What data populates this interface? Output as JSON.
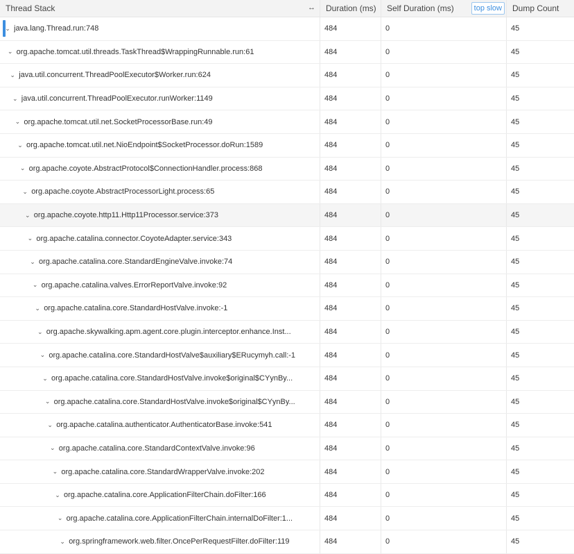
{
  "header": {
    "thread_stack": "Thread Stack",
    "resize_icon": "↔",
    "duration": "Duration (ms)",
    "self_duration": "Self Duration (ms)",
    "top_slow": "top slow",
    "dump_count": "Dump Count"
  },
  "rows": [
    {
      "label": "java.lang.Thread.run:748",
      "duration": "484",
      "self": "0",
      "count": "45"
    },
    {
      "label": "org.apache.tomcat.util.threads.TaskThread$WrappingRunnable.run:61",
      "duration": "484",
      "self": "0",
      "count": "45"
    },
    {
      "label": "java.util.concurrent.ThreadPoolExecutor$Worker.run:624",
      "duration": "484",
      "self": "0",
      "count": "45"
    },
    {
      "label": "java.util.concurrent.ThreadPoolExecutor.runWorker:1149",
      "duration": "484",
      "self": "0",
      "count": "45"
    },
    {
      "label": "org.apache.tomcat.util.net.SocketProcessorBase.run:49",
      "duration": "484",
      "self": "0",
      "count": "45"
    },
    {
      "label": "org.apache.tomcat.util.net.NioEndpoint$SocketProcessor.doRun:1589",
      "duration": "484",
      "self": "0",
      "count": "45"
    },
    {
      "label": "org.apache.coyote.AbstractProtocol$ConnectionHandler.process:868",
      "duration": "484",
      "self": "0",
      "count": "45"
    },
    {
      "label": "org.apache.coyote.AbstractProcessorLight.process:65",
      "duration": "484",
      "self": "0",
      "count": "45"
    },
    {
      "label": "org.apache.coyote.http11.Http11Processor.service:373",
      "duration": "484",
      "self": "0",
      "count": "45"
    },
    {
      "label": "org.apache.catalina.connector.CoyoteAdapter.service:343",
      "duration": "484",
      "self": "0",
      "count": "45"
    },
    {
      "label": "org.apache.catalina.core.StandardEngineValve.invoke:74",
      "duration": "484",
      "self": "0",
      "count": "45"
    },
    {
      "label": "org.apache.catalina.valves.ErrorReportValve.invoke:92",
      "duration": "484",
      "self": "0",
      "count": "45"
    },
    {
      "label": "org.apache.catalina.core.StandardHostValve.invoke:-1",
      "duration": "484",
      "self": "0",
      "count": "45"
    },
    {
      "label": "org.apache.skywalking.apm.agent.core.plugin.interceptor.enhance.Inst...",
      "duration": "484",
      "self": "0",
      "count": "45"
    },
    {
      "label": "org.apache.catalina.core.StandardHostValve$auxiliary$ERucymyh.call:-1",
      "duration": "484",
      "self": "0",
      "count": "45"
    },
    {
      "label": "org.apache.catalina.core.StandardHostValve.invoke$original$CYynBy...",
      "duration": "484",
      "self": "0",
      "count": "45"
    },
    {
      "label": "org.apache.catalina.core.StandardHostValve.invoke$original$CYynBy...",
      "duration": "484",
      "self": "0",
      "count": "45"
    },
    {
      "label": "org.apache.catalina.authenticator.AuthenticatorBase.invoke:541",
      "duration": "484",
      "self": "0",
      "count": "45"
    },
    {
      "label": "org.apache.catalina.core.StandardContextValve.invoke:96",
      "duration": "484",
      "self": "0",
      "count": "45"
    },
    {
      "label": "org.apache.catalina.core.StandardWrapperValve.invoke:202",
      "duration": "484",
      "self": "0",
      "count": "45"
    },
    {
      "label": "org.apache.catalina.core.ApplicationFilterChain.doFilter:166",
      "duration": "484",
      "self": "0",
      "count": "45"
    },
    {
      "label": "org.apache.catalina.core.ApplicationFilterChain.internalDoFilter:1...",
      "duration": "484",
      "self": "0",
      "count": "45"
    },
    {
      "label": "org.springframework.web.filter.OncePerRequestFilter.doFilter:119",
      "duration": "484",
      "self": "0",
      "count": "45"
    }
  ],
  "selected_row": 0,
  "hovered_row": 8,
  "colors": {
    "accent": "#3d8fe0",
    "header_bg": "#f3f3f3",
    "hover_bg": "#f5f5f5"
  }
}
